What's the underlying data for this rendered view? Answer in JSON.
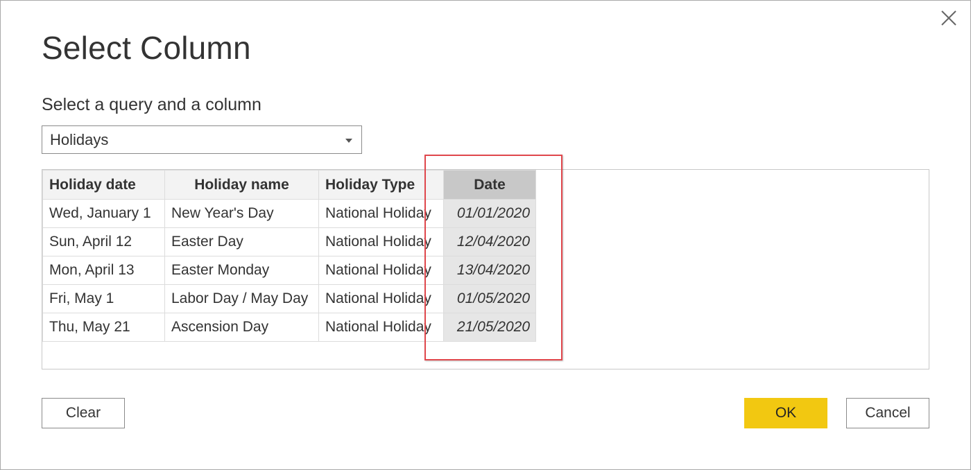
{
  "dialog": {
    "title": "Select Column",
    "subtitle": "Select a query and a column",
    "close_icon": "close-icon"
  },
  "query_select": {
    "value": "Holidays",
    "icon": "chevron-down-icon"
  },
  "table": {
    "columns": [
      "Holiday date",
      "Holiday name",
      "Holiday Type",
      "Date"
    ],
    "selected_column": "Date",
    "rows": [
      [
        "Wed, January 1",
        "New Year's Day",
        "National Holiday",
        "01/01/2020"
      ],
      [
        "Sun, April 12",
        "Easter Day",
        "National Holiday",
        "12/04/2020"
      ],
      [
        "Mon, April 13",
        "Easter Monday",
        "National Holiday",
        "13/04/2020"
      ],
      [
        "Fri, May 1",
        "Labor Day / May Day",
        "National Holiday",
        "01/05/2020"
      ],
      [
        "Thu, May 21",
        "Ascension Day",
        "National Holiday",
        "21/05/2020"
      ]
    ]
  },
  "buttons": {
    "clear": "Clear",
    "ok": "OK",
    "cancel": "Cancel"
  },
  "colors": {
    "ok_button": "#f2c811",
    "highlight_border": "#e0474c",
    "selected_header": "#c8c8c8",
    "selected_cell": "#e6e6e6"
  }
}
